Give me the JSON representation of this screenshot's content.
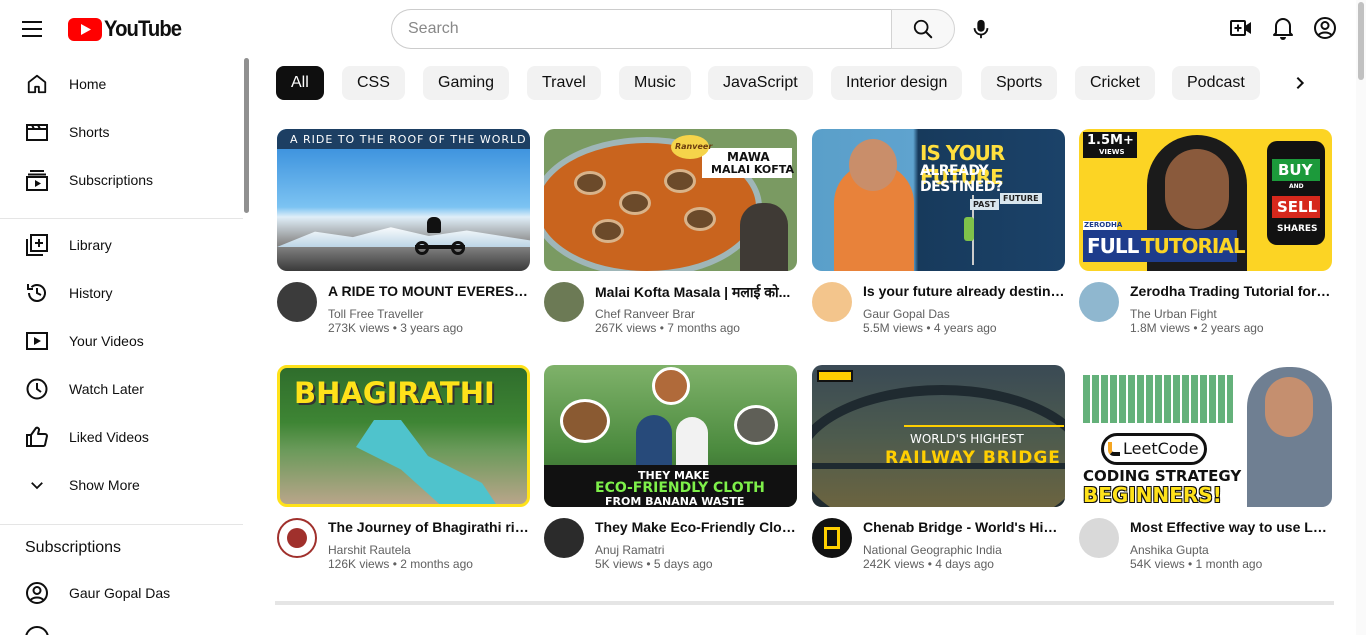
{
  "header": {
    "logo_text": "YouTube",
    "search_placeholder": "Search",
    "icons": [
      "menu-icon",
      "search-icon",
      "mic-icon",
      "create-video-icon",
      "notifications-icon",
      "account-icon"
    ]
  },
  "sidebar": {
    "items": [
      {
        "label": "Home",
        "icon": "home-icon"
      },
      {
        "label": "Shorts",
        "icon": "shorts-icon"
      },
      {
        "label": "Subscriptions",
        "icon": "subscriptions-icon"
      },
      {
        "label": "Library",
        "icon": "library-icon"
      },
      {
        "label": "History",
        "icon": "history-icon"
      },
      {
        "label": "Your Videos",
        "icon": "your-videos-icon"
      },
      {
        "label": "Watch Later",
        "icon": "watch-later-icon"
      },
      {
        "label": "Liked Videos",
        "icon": "thumbs-up-icon"
      },
      {
        "label": "Show More",
        "icon": "chevron-down-icon"
      }
    ],
    "subscriptions_heading": "Subscriptions",
    "subscriptions": [
      {
        "label": "Gaur Gopal Das",
        "icon": "account-icon"
      }
    ]
  },
  "chips": [
    "All",
    "CSS",
    "Gaming",
    "Travel",
    "Music",
    "JavaScript",
    "Interior design",
    "Sports",
    "Cricket",
    "Podcast"
  ],
  "videos": [
    {
      "title": "A RIDE TO MOUNT EVEREST | ...",
      "channel": "Toll Free Traveller",
      "meta": "273K views • 3 years ago",
      "overlay": [
        "A RIDE TO THE ROOF OF THE WORLD"
      ]
    },
    {
      "title": "Malai Kofta Masala | मलाई को...",
      "channel": "Chef Ranveer Brar",
      "meta": "267K views • 7 months ago",
      "overlay": [
        "MAWA",
        "MALAI KOFTA",
        "Ranveer"
      ]
    },
    {
      "title": "Is your future already destined...",
      "channel": "Gaur Gopal Das",
      "meta": "5.5M views • 4 years ago",
      "overlay": [
        "IS YOUR FUTURE",
        "ALREADY DESTINED?",
        "PAST",
        "FUTURE"
      ]
    },
    {
      "title": "Zerodha Trading Tutorial for B...",
      "channel": "The Urban Fight",
      "meta": "1.8M views • 2 years ago",
      "overlay": [
        "1.5M+",
        "VIEWS",
        "ZERODHA",
        "FULL",
        "TUTORIAL",
        "BUY",
        "AND",
        "SELL",
        "SHARES"
      ]
    },
    {
      "title": "The Journey of Bhagirathi rive...",
      "channel": "Harshit Rautela",
      "meta": "126K views • 2 months ago",
      "overlay": [
        "BHAGIRATHI"
      ]
    },
    {
      "title": "They Make Eco-Friendly Cloth ...",
      "channel": "Anuj Ramatri",
      "meta": "5K views • 5 days ago",
      "overlay": [
        "THEY MAKE",
        "ECO-FRIENDLY CLOTH",
        "FROM BANANA WASTE"
      ]
    },
    {
      "title": "Chenab Bridge - World's Highe...",
      "channel": "National Geographic India",
      "meta": "242K views • 4 days ago",
      "overlay": [
        "WORLD'S HIGHEST",
        "RAILWAY BRIDGE"
      ]
    },
    {
      "title": "Most Effective way to use Leet...",
      "channel": "Anshika Gupta",
      "meta": "54K views • 1 month ago",
      "overlay": [
        "LeetCode",
        "CODING STRATEGY",
        "BEGINNERS!"
      ]
    }
  ],
  "colors": {
    "brand_red": "#ff0000",
    "chip_bg": "#f2f2f2",
    "chip_active": "#0f0f0f",
    "meta_text": "#606060"
  }
}
